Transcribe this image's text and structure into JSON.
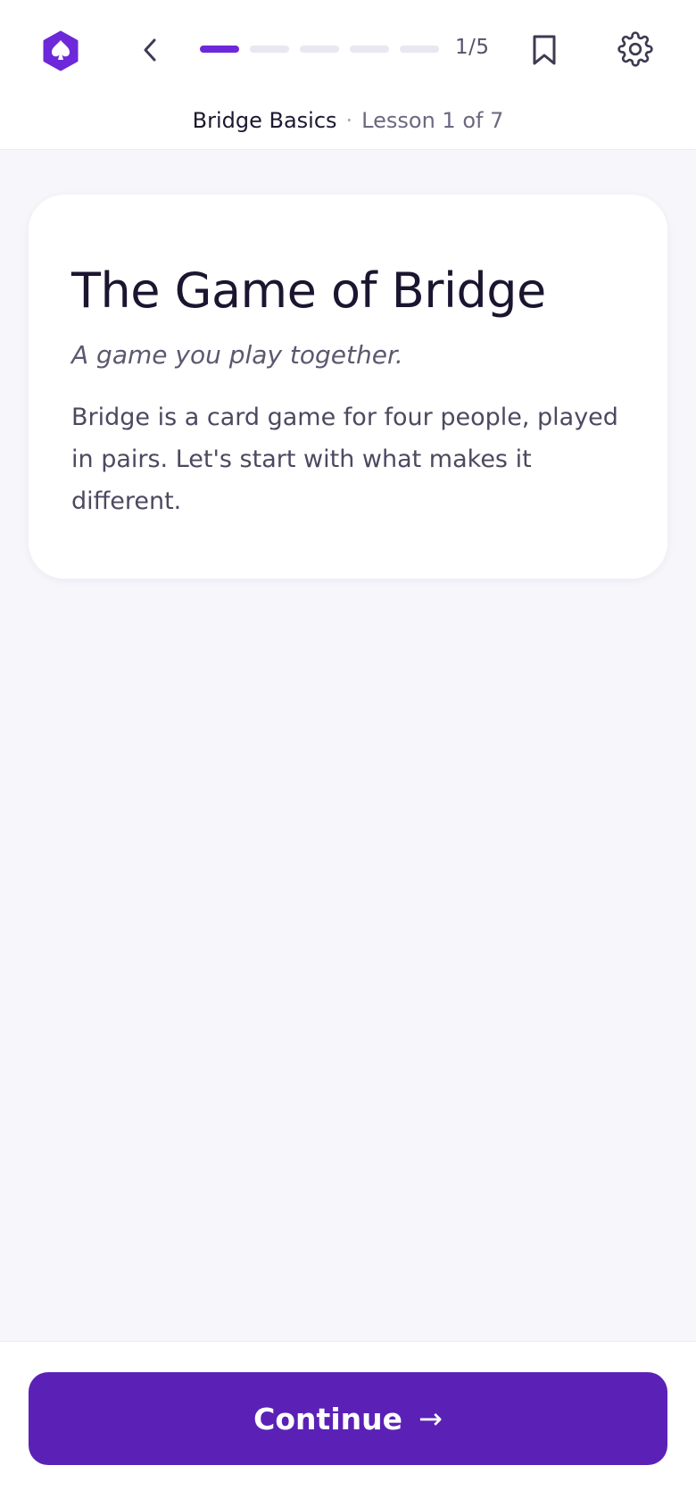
{
  "header": {
    "logo_icon": "spade-hexagon-icon",
    "back_icon": "chevron-left-icon",
    "progress": {
      "current": 1,
      "total": 5,
      "label": "1/5"
    },
    "bookmark_icon": "bookmark-icon",
    "settings_icon": "gear-icon",
    "course_title": "Bridge Basics",
    "separator": "·",
    "lesson_label": "Lesson 1 of 7"
  },
  "card": {
    "title": "The Game of Bridge",
    "tagline": "A game you play together.",
    "body": "Bridge is a card game for four people, played in pairs. Let's start with what makes it different."
  },
  "footer": {
    "continue_label": "Continue",
    "continue_arrow": "→"
  },
  "colors": {
    "accent": "#5b21b6",
    "progress_active": "#6d28d9",
    "progress_inactive": "#e9e7f0",
    "background": "#f7f6fa"
  }
}
